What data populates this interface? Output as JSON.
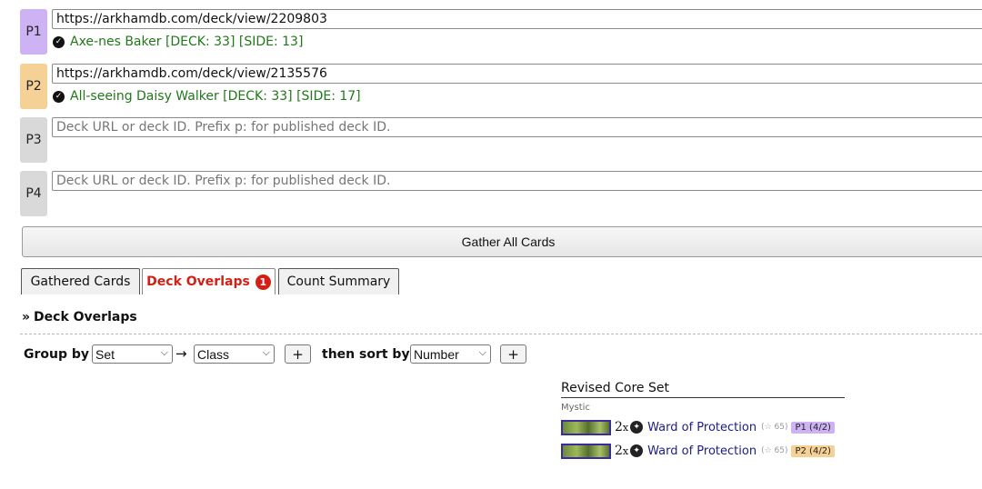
{
  "colors": {
    "p1": "#cdb3f3",
    "p2": "#f6d196",
    "p_empty": "#d9d9d9",
    "status_ok": "#22771b",
    "tab_active": "#d32016",
    "card_link": "#1c1c8c"
  },
  "players": [
    {
      "label": "P1",
      "url": "https://arkhamdb.com/deck/view/2209803",
      "status": "Axe-nes Baker [DECK: 33] [SIDE: 13]"
    },
    {
      "label": "P2",
      "url": "https://arkhamdb.com/deck/view/2135576",
      "status": "All-seeing Daisy Walker [DECK: 33] [SIDE: 17]"
    },
    {
      "label": "P3",
      "url": "",
      "placeholder": "Deck URL or deck ID. Prefix p: for published deck ID."
    },
    {
      "label": "P4",
      "url": "",
      "placeholder": "Deck URL or deck ID. Prefix p: for published deck ID."
    }
  ],
  "gather_button": "Gather All Cards",
  "tabs": [
    {
      "label": "Gathered Cards"
    },
    {
      "label": "Deck Overlaps",
      "badge": "1",
      "active": true
    },
    {
      "label": "Count Summary"
    }
  ],
  "section_title": "Deck Overlaps",
  "section_icon": "double-chevron-right-icon",
  "controls": {
    "group_by_label": "Group by",
    "group_by_1": "Set",
    "arrow": "→",
    "group_by_2": "Class",
    "add_label": "+",
    "sort_label": "then sort by",
    "sort_by": "Number"
  },
  "overlap_group": {
    "set": "Revised Core Set",
    "class": "Mystic",
    "cards": [
      {
        "qty": "2",
        "qty_suffix": "x",
        "class_icon": "mystic-icon",
        "name": "Ward of Protection",
        "number": "65",
        "owner": "P1 (4/2)"
      },
      {
        "qty": "2",
        "qty_suffix": "x",
        "class_icon": "mystic-icon",
        "name": "Ward of Protection",
        "number": "65",
        "owner": "P2 (4/2)"
      }
    ]
  }
}
